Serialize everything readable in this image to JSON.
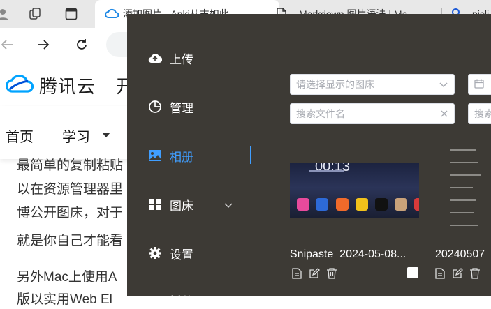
{
  "browser": {
    "tabs": [
      {
        "title": "添加图片 - Anki从末如此",
        "icon": "cloud-logo-icon"
      },
      {
        "title": "Markdown 图片语法 | Ma",
        "icon": "document-icon"
      },
      {
        "title": "picli",
        "icon": "search-icon"
      }
    ]
  },
  "site": {
    "logo_text": "腾讯云",
    "header_fragment": "开",
    "nav": {
      "home": "首页",
      "learn": "学习"
    },
    "article_lines": [
      "最简单的复制粘贴",
      "以在资源管理器里",
      "博公开图床，对于",
      "就是你自己才能看",
      "另外Mac上使用A",
      "版以实用Web El"
    ]
  },
  "picgo": {
    "menu": [
      {
        "label": "上传",
        "icon": "cloud-upload-icon"
      },
      {
        "label": "管理",
        "icon": "pie-chart-icon"
      },
      {
        "label": "相册",
        "icon": "picture-icon"
      },
      {
        "label": "图床",
        "icon": "grid-icon"
      },
      {
        "label": "设置",
        "icon": "gear-icon"
      },
      {
        "label": "插件",
        "icon": "plugin-icon"
      }
    ],
    "bed_select_placeholder": "请选择显示的图床",
    "search_placeholder": "搜索文件名",
    "search2_placeholder": "搜索",
    "phone_time": "00:13",
    "items": [
      {
        "filename": "Snipaste_2024-05-08..."
      },
      {
        "filename": "20240507"
      }
    ],
    "accent_color": "#409eff"
  }
}
